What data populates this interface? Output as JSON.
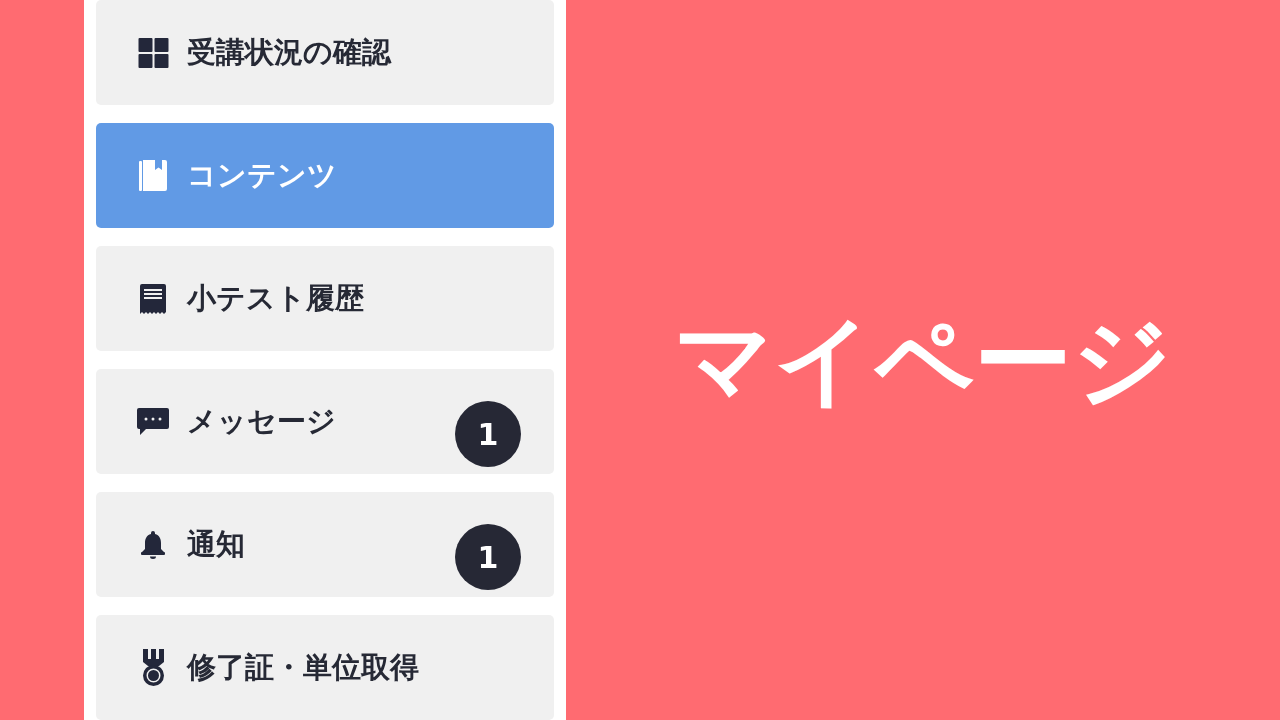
{
  "sidebar": {
    "items": [
      {
        "label": "受講状況の確認",
        "selected": false
      },
      {
        "label": "コンテンツ",
        "selected": true
      },
      {
        "label": "小テスト履歴",
        "selected": false
      },
      {
        "label": "メッセージ",
        "selected": false,
        "badge": "1"
      },
      {
        "label": "通知",
        "selected": false,
        "badge": "1"
      },
      {
        "label": "修了証・単位取得",
        "selected": false
      }
    ]
  },
  "title": "マイページ"
}
